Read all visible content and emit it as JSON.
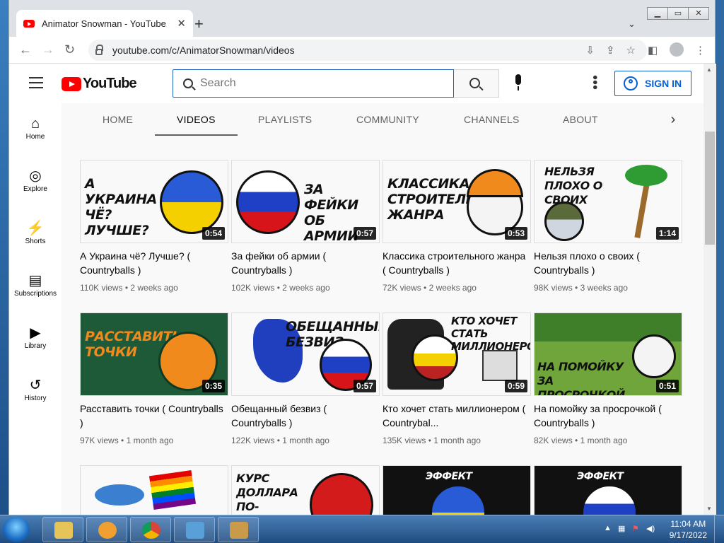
{
  "browser": {
    "tab_title": "Animator Snowman - YouTube",
    "tab_close": "✕",
    "new_tab": "+",
    "tab_search": "⌄",
    "url": "youtube.com/c/AnimatorSnowman/videos",
    "window_controls": [
      "▁",
      "▭",
      "✕"
    ]
  },
  "youtube": {
    "logo_text": "YouTube",
    "search_placeholder": "Search",
    "sign_in": "SIGN IN"
  },
  "sidebar": {
    "items": [
      {
        "label": "Home",
        "icon": "⌂"
      },
      {
        "label": "Explore",
        "icon": "◎"
      },
      {
        "label": "Shorts",
        "icon": "⚡"
      },
      {
        "label": "Subscriptions",
        "icon": "▤"
      },
      {
        "label": "Library",
        "icon": "▶"
      },
      {
        "label": "History",
        "icon": "↺"
      }
    ]
  },
  "channel_tabs": [
    "HOME",
    "VIDEOS",
    "PLAYLISTS",
    "COMMUNITY",
    "CHANNELS",
    "ABOUT"
  ],
  "videos": [
    {
      "title": "А Украина чё? Лучше? ( Countryballs )",
      "views": "110K views",
      "age": "2 weeks ago",
      "duration": "0:54",
      "thumb_text": "А УКРАИНА ЧЁ? ЛУЧШЕ?",
      "bg": "#ffffff"
    },
    {
      "title": "За фейки об армии ( Countryballs )",
      "views": "102K views",
      "age": "2 weeks ago",
      "duration": "0:57",
      "thumb_text": "ЗА ФЕЙКИ ОБ АРМИИ",
      "bg": "#ffffff"
    },
    {
      "title": "Классика строительного жанра ( Countryballs )",
      "views": "72K views",
      "age": "2 weeks ago",
      "duration": "0:53",
      "thumb_text": "КЛАССИКА СТРОИТЕЛЬНОГО ЖАНРА",
      "bg": "#ffffff"
    },
    {
      "title": "Нельзя плохо о своих ( Countryballs )",
      "views": "98K views",
      "age": "3 weeks ago",
      "duration": "1:14",
      "thumb_text": "НЕЛЬЗЯ ПЛОХО О СВОИХ",
      "bg": "#ffffff"
    },
    {
      "title": "Расставить точки ( Countryballs )",
      "views": "97K views",
      "age": "1 month ago",
      "duration": "0:35",
      "thumb_text": "РАССТАВИТЬ ТОЧКИ",
      "bg": "#1e5a38"
    },
    {
      "title": "Обещанный безвиз ( Countryballs )",
      "views": "122K views",
      "age": "1 month ago",
      "duration": "0:57",
      "thumb_text": "ОБЕЩАННЫЙ БЕЗВИЗ",
      "bg": "#ffffff"
    },
    {
      "title": "Кто хочет стать миллионером ( Countrybal...",
      "views": "135K views",
      "age": "1 month ago",
      "duration": "0:59",
      "thumb_text": "КТО ХОЧЕТ СТАТЬ МИЛЛИОНЕРОМ",
      "bg": "#ffffff"
    },
    {
      "title": "На помойку за просрочкой ( Countryballs )",
      "views": "82K views",
      "age": "1 month ago",
      "duration": "0:51",
      "thumb_text": "НА ПОМОЙКУ ЗА ПРОСРОЧКОЙ",
      "bg": "#6fa53a"
    },
    {
      "title": "",
      "views": "",
      "age": "",
      "duration": "",
      "thumb_text": "",
      "bg": "#ffffff"
    },
    {
      "title": "",
      "views": "",
      "age": "",
      "duration": "",
      "thumb_text": "КУРС ДОЛЛАРА ПО-СОВЕТСКИ",
      "bg": "#ffffff"
    },
    {
      "title": "",
      "views": "",
      "age": "",
      "duration": "",
      "thumb_text": "ЭФФЕКТ",
      "bg": "#111111"
    },
    {
      "title": "",
      "views": "",
      "age": "",
      "duration": "",
      "thumb_text": "ЭФФЕКТ",
      "bg": "#111111"
    }
  ],
  "taskbar": {
    "time": "11:04 AM",
    "date": "9/17/2022"
  },
  "colors": {
    "yt_red": "#ff0000",
    "link_blue": "#065fd4"
  }
}
